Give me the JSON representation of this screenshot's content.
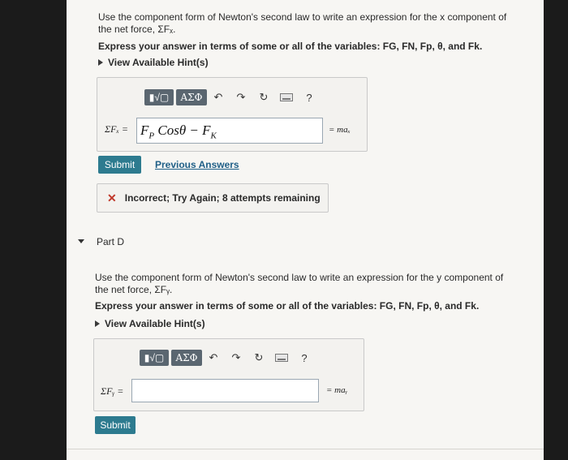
{
  "part_c": {
    "question": "Use the component form of Newton's second law to write an expression for the x component of the net force, ΣFₓ.",
    "express": "Express your answer in terms of some or all of the variables: F",
    "vars": "G, FN, Fp, θ, and Fk.",
    "express_full": "Express your answer in terms of some or all of the variables: FG, FN, Fp, θ, and Fk.",
    "hint": "View Available Hint(s)",
    "lhs": "ΣFₓ =",
    "answer_value": "F_P Cosθ − F_K",
    "answer_main": "F",
    "answer_sub1": "P",
    "answer_mid": " Cosθ − F",
    "answer_sub2": "K",
    "rhs": "= maₓ",
    "submit": "Submit",
    "previous": "Previous Answers",
    "feedback": "Incorrect; Try Again; 8 attempts remaining"
  },
  "part_d": {
    "title": "Part D",
    "question": "Use the component form of Newton's second law to write an expression for the y component of the net force, ΣFᵧ.",
    "express_full": "Express your answer in terms of some or all of the variables: FG, FN, Fp, θ, and Fk.",
    "hint": "View Available Hint(s)",
    "lhs": "ΣFᵧ =",
    "answer_value": "",
    "rhs": "= maᵧ",
    "submit": "Submit"
  },
  "toolbar": {
    "templates_label": "▮√▢",
    "symbols_label": "ΑΣΦ",
    "help_label": "?"
  },
  "colors": {
    "submit": "#2d7b8f",
    "link": "#1f5f87",
    "error": "#c0392b"
  }
}
